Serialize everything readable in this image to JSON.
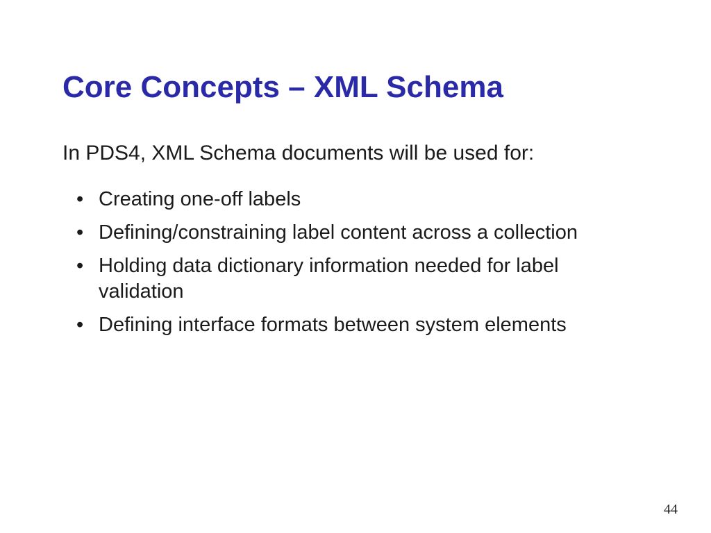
{
  "slide": {
    "title": "Core Concepts – XML Schema",
    "intro": "In PDS4, XML Schema documents will be used for:",
    "bullets": [
      "Creating one-off labels",
      "Defining/constraining label content across a collection",
      "Holding data dictionary information needed for label validation",
      "Defining interface formats between system elements"
    ],
    "pageNumber": "44"
  }
}
